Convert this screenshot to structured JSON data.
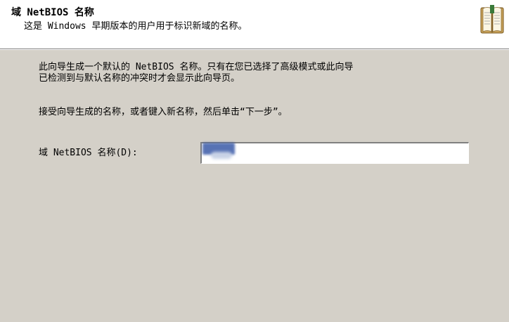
{
  "header": {
    "title": "域 NetBIOS 名称",
    "subtitle": "这是 Windows 早期版本的用户用于标识新域的名称。",
    "icon": "book-icon"
  },
  "content": {
    "paragraph1_line1": "此向导生成一个默认的 NetBIOS 名称。只有在您已选择了高级模式或此向导",
    "paragraph1_line2": "已检测到与默认名称的冲突时才会显示此向导页。",
    "paragraph2": "接受向导生成的名称，或者键入新名称，然后单击“下一步”。",
    "field_label": "域 NetBIOS 名称(D):",
    "field_value": ""
  },
  "colors": {
    "dialog_background": "#d4d0c8",
    "header_background": "#ffffff",
    "selection": "#3a5aa8"
  }
}
